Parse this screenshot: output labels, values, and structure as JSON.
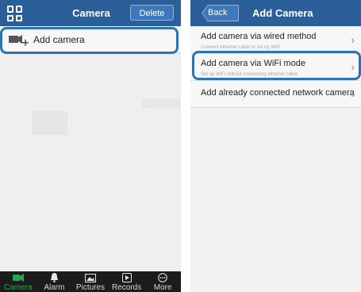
{
  "left": {
    "title": "Camera",
    "delete_label": "Delete",
    "add_camera_label": "Add camera",
    "tabs": [
      {
        "label": "Camera",
        "icon": "camera-icon",
        "active": true
      },
      {
        "label": "Alarm",
        "icon": "bell-icon",
        "active": false
      },
      {
        "label": "Pictures",
        "icon": "picture-icon",
        "active": false
      },
      {
        "label": "Records",
        "icon": "play-icon",
        "active": false
      },
      {
        "label": "More",
        "icon": "more-icon",
        "active": false
      }
    ]
  },
  "right": {
    "back_label": "Back",
    "title": "Add Camera",
    "items": [
      {
        "title": "Add camera via wired method",
        "subtitle": "Connect ethernet cable to set up WiFi"
      },
      {
        "title": "Add camera via WiFi mode",
        "subtitle": "Set up WiFi without connecting ethernet cable"
      },
      {
        "title": "Add already connected network camera",
        "subtitle": ""
      }
    ]
  },
  "colors": {
    "header": "#2b5f9a",
    "highlight": "#2f72b0",
    "tab_active": "#2aa54e",
    "tabbar": "#1c1c1c"
  }
}
